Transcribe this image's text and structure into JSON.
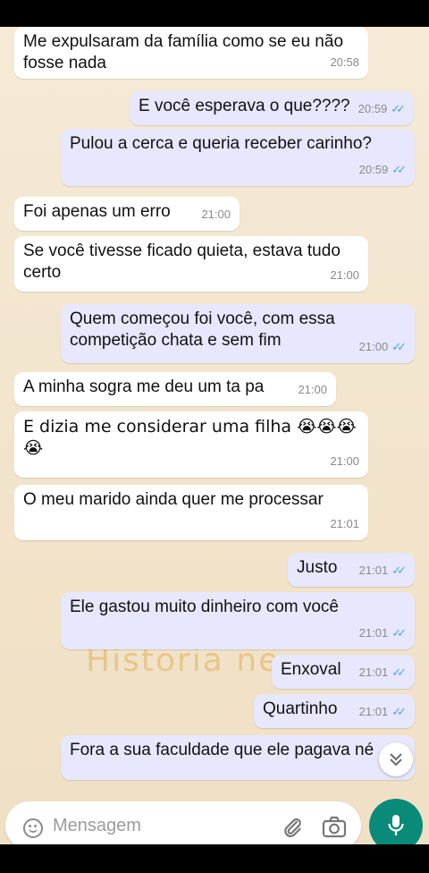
{
  "chat": {
    "watermark_text": "Historia ne",
    "messages": [
      {
        "dir": "in",
        "text": "Me expulsaram da família como se eu não\nfosse nada",
        "time": "20:58"
      },
      {
        "dir": "out",
        "text": "E você esperava o que????",
        "time": "20:59",
        "read": true
      },
      {
        "dir": "out",
        "text": "Pulou a cerca e queria receber carinho?",
        "time": "20:59",
        "read": true
      },
      {
        "dir": "in",
        "text": "Foi apenas um erro",
        "time": "21:00"
      },
      {
        "dir": "in",
        "text": "Se você tivesse ficado quieta, estava tudo\ncerto",
        "time": "21:00"
      },
      {
        "dir": "out",
        "text": "Quem começou foi você, com essa\ncompetição chata e sem fim",
        "time": "21:00",
        "read": true
      },
      {
        "dir": "in",
        "text": "A minha sogra me deu um ta pa",
        "time": "21:00"
      },
      {
        "dir": "in",
        "text": "E dizia me considerar uma filha 😭😭😭\n😭",
        "time": "21:00"
      },
      {
        "dir": "in",
        "text": "O meu marido ainda quer me processar",
        "time": "21:01"
      },
      {
        "dir": "out",
        "text": "Justo",
        "time": "21:01",
        "read": true
      },
      {
        "dir": "out",
        "text": "Ele gastou muito dinheiro com você",
        "time": "21:01",
        "read": true
      },
      {
        "dir": "out",
        "text": "Enxoval",
        "time": "21:01",
        "read": true
      },
      {
        "dir": "out",
        "text": "Quartinho",
        "time": "21:01",
        "read": true
      },
      {
        "dir": "out",
        "text": "Fora a sua faculdade que ele pagava né",
        "time": ""
      }
    ]
  },
  "composer": {
    "placeholder": "Mensagem",
    "icons": [
      "emoji-icon",
      "attach-icon",
      "camera-icon",
      "mic-icon"
    ]
  },
  "scroll_down": {
    "icon": "double-chevron-down-icon"
  },
  "colors": {
    "incoming": "#ffffff",
    "outgoing": "#e7e7fd",
    "read_ticks": "#4fa4e8",
    "mic_button": "#0a8a78"
  }
}
